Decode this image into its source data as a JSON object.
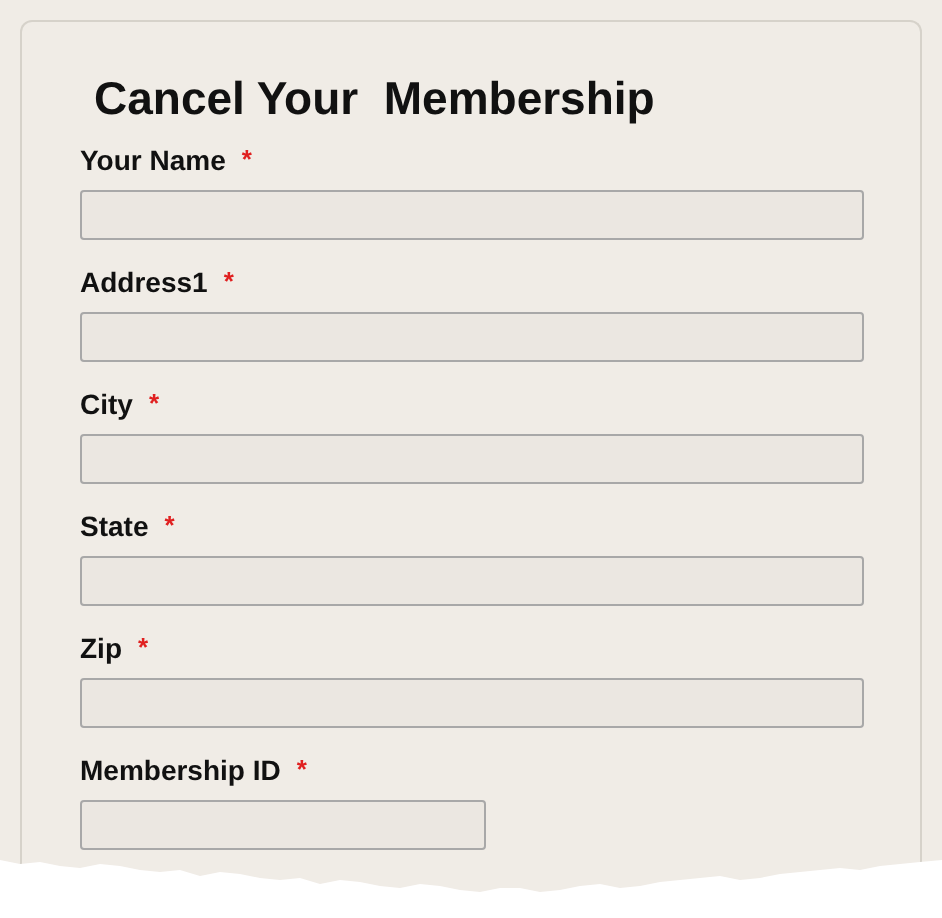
{
  "form": {
    "title": "Cancel Your  Membership",
    "fields": [
      {
        "label": "Your Name",
        "required_mark": "*",
        "kind": "wide"
      },
      {
        "label": "Address1",
        "required_mark": "*",
        "kind": "wide"
      },
      {
        "label": "City",
        "required_mark": "*",
        "kind": "wide"
      },
      {
        "label": "State",
        "required_mark": "*",
        "kind": "wide"
      },
      {
        "label": "Zip",
        "required_mark": "*",
        "kind": "wide"
      },
      {
        "label": "Membership ID",
        "required_mark": "*",
        "kind": "short"
      }
    ]
  }
}
